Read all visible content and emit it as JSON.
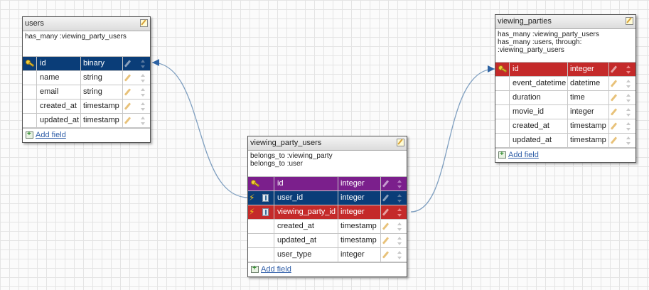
{
  "colors": {
    "pk_blue": "#0a3d78",
    "fk_red": "#c42a2a",
    "pk_purple": "#7b1f8c",
    "link_line": "#7f9fc0",
    "link_arrow": "#2e63a3",
    "add_link": "#2f5ea8"
  },
  "icons": [
    "key-icon",
    "bolt-icon",
    "link-icon",
    "pencil-icon",
    "sort-arrows-icon",
    "note-icon",
    "add-field-icon"
  ],
  "tables": {
    "users": {
      "name": "users",
      "associations": [
        "has_many :viewing_party_users",
        ""
      ],
      "columns": [
        {
          "name": "id",
          "type": "binary"
        },
        {
          "name": "name",
          "type": "string"
        },
        {
          "name": "email",
          "type": "string"
        },
        {
          "name": "created_at",
          "type": "timestamp"
        },
        {
          "name": "updated_at",
          "type": "timestamp"
        }
      ],
      "add_field": "Add field"
    },
    "viewing_party_users": {
      "name": "viewing_party_users",
      "associations": [
        "belongs_to :viewing_party",
        "belongs_to :user"
      ],
      "columns": [
        {
          "name": "id",
          "type": "integer"
        },
        {
          "name": "user_id",
          "type": "integer"
        },
        {
          "name": "viewing_party_id",
          "type": "integer"
        },
        {
          "name": "created_at",
          "type": "timestamp"
        },
        {
          "name": "updated_at",
          "type": "timestamp"
        },
        {
          "name": "user_type",
          "type": "integer"
        }
      ],
      "add_field": "Add field"
    },
    "viewing_parties": {
      "name": "viewing_parties",
      "associations": [
        "has_many :viewing_party_users",
        "has_many :users, through:",
        ":viewing_party_users"
      ],
      "columns": [
        {
          "name": "id",
          "type": "integer"
        },
        {
          "name": "event_datetime",
          "type": "datetime"
        },
        {
          "name": "duration",
          "type": "time"
        },
        {
          "name": "movie_id",
          "type": "integer"
        },
        {
          "name": "created_at",
          "type": "timestamp"
        },
        {
          "name": "updated_at",
          "type": "timestamp"
        }
      ],
      "add_field": "Add field"
    }
  }
}
